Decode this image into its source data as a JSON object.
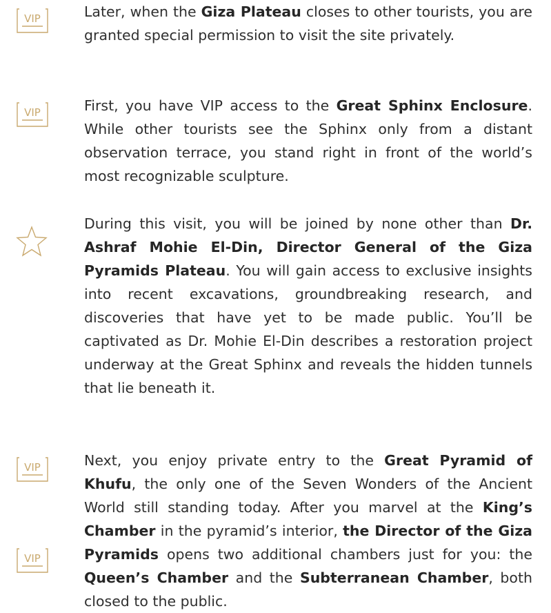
{
  "icons": {
    "vip_label": "VIP",
    "accent_color": "#c9a96e",
    "items": [
      "vip-icon",
      "vip-icon",
      "star-icon",
      "vip-icon",
      "vip-icon"
    ]
  },
  "paragraphs": [
    {
      "segments": [
        {
          "text": "Later, when the ",
          "bold": false
        },
        {
          "text": "Giza Plateau",
          "bold": true
        },
        {
          "text": " closes to other tourists, you are granted special permission to visit the site privately.",
          "bold": false
        }
      ]
    },
    {
      "segments": [
        {
          "text": "First, you have VIP access to the ",
          "bold": false
        },
        {
          "text": "Great Sphinx Enclosure",
          "bold": true
        },
        {
          "text": ". While other tourists see the Sphinx only from a distant observation terrace, you stand right in front of the world’s most recognizable sculpture.",
          "bold": false
        }
      ]
    },
    {
      "segments": [
        {
          "text": "During this visit, you will be joined by none other than ",
          "bold": false
        },
        {
          "text": "Dr. Ashraf Mohie El-Din, Director General of the Giza Pyramids Plateau",
          "bold": true
        },
        {
          "text": ". You will gain access to exclusive insights into recent excavations, groundbreaking research, and discoveries that have yet to be made public. You’ll be captivated as Dr. Mohie El-Din describes a restoration project underway at the Great Sphinx and reveals the hidden tunnels that lie beneath it.",
          "bold": false
        }
      ]
    },
    {
      "segments": [
        {
          "text": "Next, you enjoy private entry to the ",
          "bold": false
        },
        {
          "text": "Great Pyramid of Khufu",
          "bold": true
        },
        {
          "text": ", the only one of the Seven Wonders of the Ancient World still standing today. After you marvel at the ",
          "bold": false
        },
        {
          "text": "King’s Chamber",
          "bold": true
        },
        {
          "text": " in the pyramid’s interior, ",
          "bold": false
        },
        {
          "text": "the Director of the Giza Pyramids",
          "bold": true
        },
        {
          "text": " opens two additional chambers just for you: the ",
          "bold": false
        },
        {
          "text": "Queen’s Chamber",
          "bold": true
        },
        {
          "text": " and the ",
          "bold": false
        },
        {
          "text": "Subterranean Chamber",
          "bold": true
        },
        {
          "text": ", both closed to the public.",
          "bold": false
        }
      ]
    }
  ]
}
